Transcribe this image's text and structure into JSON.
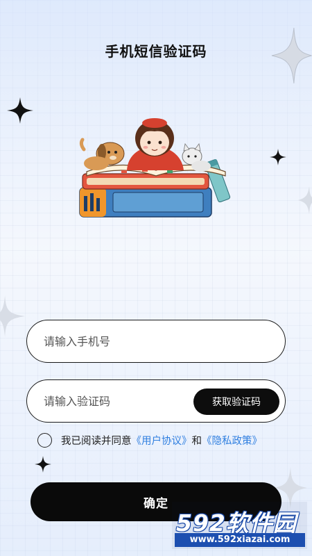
{
  "header": {
    "title": "手机短信验证码"
  },
  "form": {
    "phone_placeholder": "请输入手机号",
    "code_placeholder": "请输入验证码",
    "get_code_label": "获取验证码"
  },
  "agreement": {
    "prefix": "我已阅读并同意",
    "user_agreement": "《用户协议》",
    "and": "和",
    "privacy_policy": "《隐私政策》",
    "checked": false
  },
  "confirm": {
    "label": "确定"
  },
  "watermark": {
    "logo": "592软件园",
    "url": "www.592xiazai.com"
  },
  "colors": {
    "accent": "#0a0a0a",
    "link": "#2f7fe0"
  }
}
